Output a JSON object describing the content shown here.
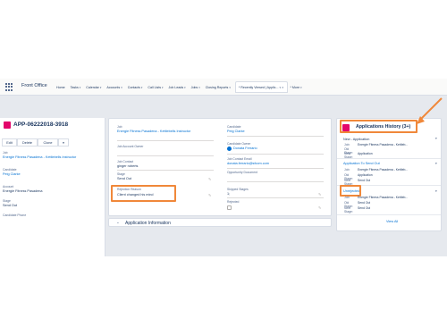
{
  "nav": {
    "app_name": "Front Office",
    "items": [
      "Home",
      "Tasks",
      "Calendar",
      "Accounts",
      "Contacts",
      "Call Lists",
      "Job Leads",
      "Jobs",
      "Closing Reports"
    ],
    "recent_tab": "* Recently Viewed | Applic...",
    "more": "* More"
  },
  "record": {
    "title": "APP-06222018-3918",
    "buttons": [
      "Edit",
      "Delete",
      "Clone"
    ],
    "fields": [
      {
        "label": "Job",
        "value": "Energie Fitness Pasadena - Kettlebells Instructor"
      },
      {
        "label": "Candidate",
        "value": "Peig Clarke"
      },
      {
        "label": "Account",
        "value": "Energie Fitness Pasadena"
      },
      {
        "label": "Stage",
        "value": "Send Out"
      },
      {
        "label": "Candidate Phone",
        "value": ""
      }
    ]
  },
  "details": {
    "job_label": "Job",
    "job_value": "Energie Fitness Pasadena - Kettlebells Instructor",
    "account_owner_label": "Job Account Owner",
    "job_contact_label": "Job Contact",
    "job_contact_value": "ginger roberts",
    "stage_label": "Stage",
    "stage_value": "Send Out",
    "rejection_label": "Rejection Reason",
    "rejection_value": "Client changed his mind",
    "candidate_label": "Candidate",
    "candidate_value": "Peig Clarke",
    "candidate_owner_label": "Candidate Owner",
    "candidate_owner_value": "Donata Ferrario",
    "contact_email_label": "Job Contact Email",
    "contact_email_value": "donata.ferrario@sfcom.com",
    "opportunity_label": "Opportunity Document",
    "skipped_label": "Skipped Stages",
    "skipped_value": "1;",
    "rejected_label": "Rejected",
    "section_title": "Application Information"
  },
  "history": {
    "title": "Applications History (3+)",
    "header_row": "New - Application",
    "view_all": "View All",
    "groups": [
      {
        "heading": "",
        "rows": [
          {
            "k": "Job:",
            "v": "Energie Fitness Pasadena - Kettleb..."
          },
          {
            "k": "Old Stage:",
            "v": ""
          },
          {
            "k": "New Stage:",
            "v": "Application"
          }
        ]
      },
      {
        "heading": "Application To Send Out",
        "rows": [
          {
            "k": "Job:",
            "v": "Energie Fitness Pasadena - Kettleb..."
          },
          {
            "k": "Old Stage:",
            "v": "Application"
          },
          {
            "k": "New Stage:",
            "v": "Send Out"
          }
        ]
      },
      {
        "heading": "Unrejected",
        "rows": [
          {
            "k": "Job:",
            "v": "Energie Fitness Pasadena - Kettleb..."
          },
          {
            "k": "Old Stage:",
            "v": "Send Out"
          },
          {
            "k": "New Stage:",
            "v": "Send Out"
          }
        ]
      }
    ]
  },
  "colors": {
    "highlight": "#f0883a",
    "brand_icon": "#e3066b",
    "link": "#0070d2"
  }
}
